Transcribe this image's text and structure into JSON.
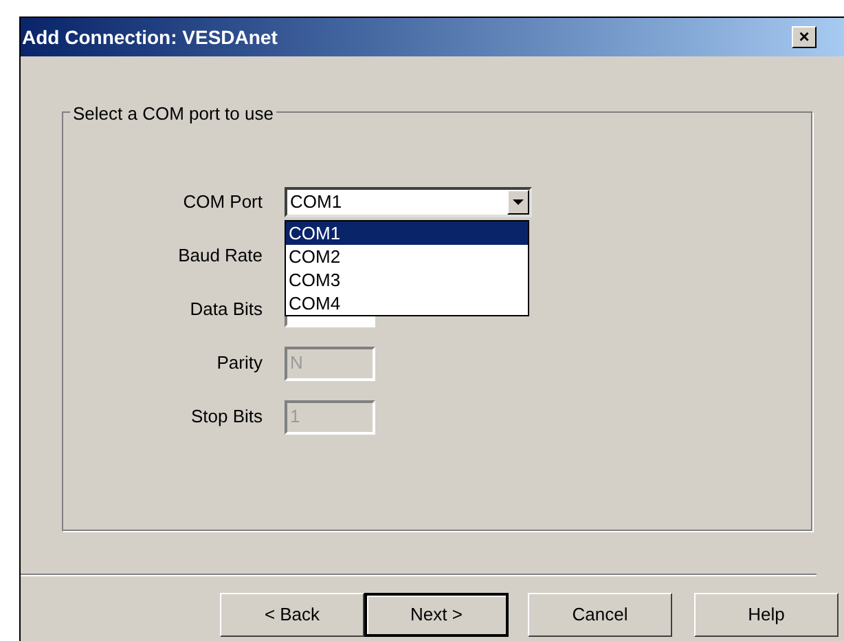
{
  "window": {
    "title": "Add Connection: VESDAnet",
    "close": "×"
  },
  "group": {
    "title": "Select a COM port to use"
  },
  "fields": [
    {
      "label": "COM Port",
      "kind": "combo",
      "value": "COM1"
    },
    {
      "label": "Baud Rate",
      "kind": "text"
    },
    {
      "label": "Data Bits",
      "kind": "text"
    },
    {
      "label": "Parity",
      "kind": "text",
      "value": "N",
      "disabled": true
    },
    {
      "label": "Stop Bits",
      "kind": "text",
      "value": "1",
      "disabled": true
    }
  ],
  "dropdown": {
    "options": [
      {
        "label": "COM1",
        "selected": true
      },
      {
        "label": "COM2",
        "selected": false
      },
      {
        "label": "COM3",
        "selected": false
      },
      {
        "label": "COM4",
        "selected": false
      }
    ]
  },
  "buttons": [
    {
      "label": "< Back",
      "default": false
    },
    {
      "label": "Next >",
      "default": true
    },
    {
      "label": "Cancel",
      "default": false
    },
    {
      "label": "Help",
      "default": false
    }
  ]
}
